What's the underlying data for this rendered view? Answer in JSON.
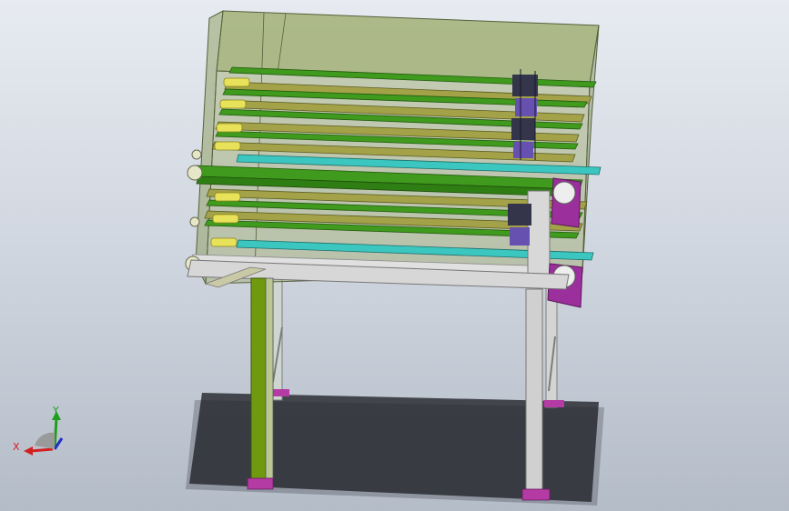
{
  "viewport": {
    "background_top": "#e7ebf1",
    "background_bottom": "#b4bcc8"
  },
  "model": {
    "colors": {
      "enclosure": "#9aa865",
      "enclosure_edge": "#55603a",
      "rail_green": "#3f9a1d",
      "rail_olive": "#a3a248",
      "rail_cyan": "#3cc6c0",
      "roller_yellow": "#e8e25a",
      "chain_dark": "#34344a",
      "chain_purple": "#6650b0",
      "bracket_magenta": "#9b2f9b",
      "frame_gray": "#d7d7d7",
      "leg_green": "#6f9a10",
      "foot_magenta": "#b43aa4",
      "shadow": "#1f2126"
    }
  },
  "triad": {
    "x_label": "X",
    "y_label": "Y",
    "x_color": "#d22020",
    "y_color": "#1ea01e",
    "z_color": "#2030c8"
  }
}
